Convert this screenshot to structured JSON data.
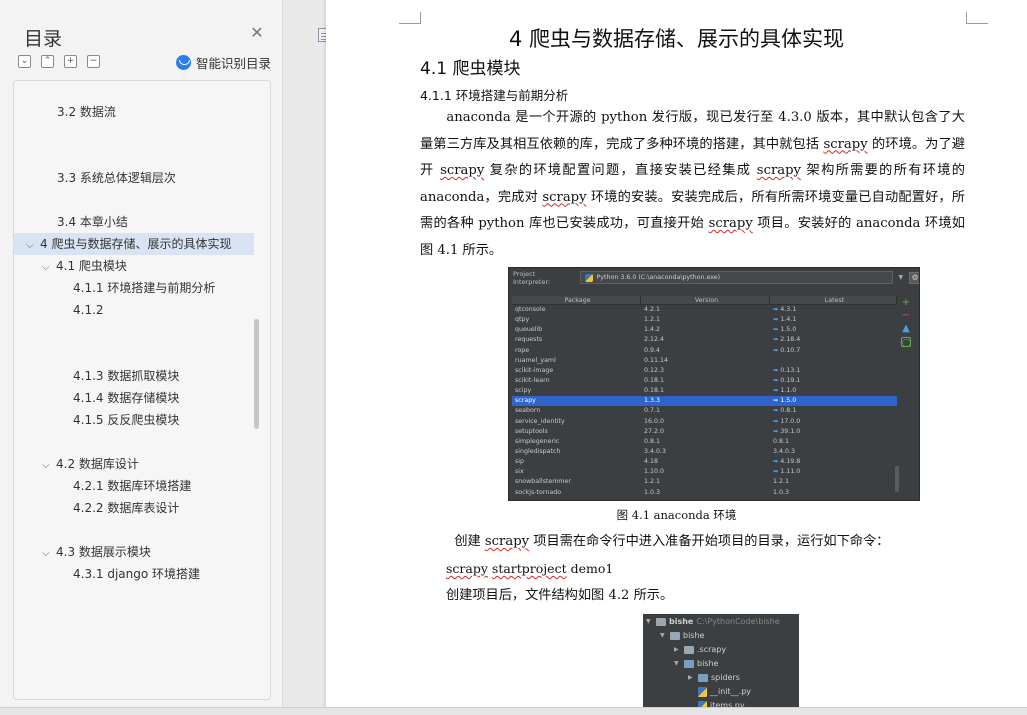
{
  "toc": {
    "title": "目录",
    "smart_label": "智能识别目录",
    "items": [
      {
        "label": "3.2  数据流",
        "level": 2
      },
      {
        "label": "3.3  系统总体逻辑层次",
        "level": 2
      },
      {
        "label": "3.4  本章小结",
        "level": 2
      },
      {
        "label": "4  爬虫与数据存储、展示的具体实现",
        "level": 1,
        "active": true
      },
      {
        "label": "4.1  爬虫模块",
        "level": 2
      },
      {
        "label": "4.1.1  环境搭建与前期分析",
        "level": 3
      },
      {
        "label": "4.1.2",
        "level": 3
      },
      {
        "label": "4.1.3  数据抓取模块",
        "level": 3
      },
      {
        "label": "4.1.4  数据存储模块",
        "level": 3
      },
      {
        "label": "4.1.5  反反爬虫模块",
        "level": 3
      },
      {
        "label": "4.2  数据库设计",
        "level": 2
      },
      {
        "label": "4.2.1  数据库环境搭建",
        "level": 3
      },
      {
        "label": "4.2.2  数据库表设计",
        "level": 3
      },
      {
        "label": "4.3  数据展示模块",
        "level": 2
      },
      {
        "label": "4.3.1 django 环境搭建",
        "level": 3
      }
    ]
  },
  "doc": {
    "chapter_title": "4  爬虫与数据存储、展示的具体实现",
    "section_title": "4.1  爬虫模块",
    "subsection_title": "4.1.1  环境搭建与前期分析",
    "para1": {
      "p1": "anaconda 是一个开源的 python 发行版，现已发行至 4.3.0 版本，其中默认包含了大量第三方库及其相互依赖的库，完成了多种环境的搭建，其中就包括 ",
      "w1": "scrapy",
      "p2": " 的环境。为了避开 ",
      "w2": "scrapy",
      "p3": " 复杂的环境配置问题，直接安装已经集成 ",
      "w3": "scrapy",
      "p4": " 架构所需要的所有环境的 anaconda，完成对 ",
      "w4": "scrapy",
      "p5": " 环境的安装。安装完成后，所有所需环境变量已自动配置好，所需的各种 python 库也已安装成功，可直接开始 ",
      "w5": "scrapy",
      "p6": " 项目。安装好的 anaconda 环境如图 4.1 所示。"
    },
    "fig1": {
      "interpreter_label": "Project Interpreter:",
      "interpreter_value": "Python 3.6.0 (C:\\anaconda\\python.exe)",
      "headers": [
        "Package",
        "Version",
        "Latest"
      ],
      "rows": [
        [
          "qtconsole",
          "4.2.1",
          "4.3.1",
          true
        ],
        [
          "qtpy",
          "1.2.1",
          "1.4.1",
          true
        ],
        [
          "queuelib",
          "1.4.2",
          "1.5.0",
          true
        ],
        [
          "requests",
          "2.12.4",
          "2.18.4",
          true
        ],
        [
          "rope",
          "0.9.4",
          "0.10.7",
          true
        ],
        [
          "ruamel_yaml",
          "0.11.14",
          "",
          false
        ],
        [
          "scikit-image",
          "0.12.3",
          "0.13.1",
          true
        ],
        [
          "scikit-learn",
          "0.18.1",
          "0.19.1",
          true
        ],
        [
          "scipy",
          "0.18.1",
          "1.1.0",
          true
        ],
        [
          "scrapy",
          "1.3.3",
          "1.5.0",
          true
        ],
        [
          "seaborn",
          "0.7.1",
          "0.8.1",
          true
        ],
        [
          "service_identity",
          "16.0.0",
          "17.0.0",
          true
        ],
        [
          "setuptools",
          "27.2.0",
          "39.1.0",
          true
        ],
        [
          "simplegeneric",
          "0.8.1",
          "0.8.1",
          false
        ],
        [
          "singledispatch",
          "3.4.0.3",
          "3.4.0.3",
          false
        ],
        [
          "sip",
          "4.18",
          "4.19.8",
          true
        ],
        [
          "six",
          "1.10.0",
          "1.11.0",
          true
        ],
        [
          "snowballstemmer",
          "1.2.1",
          "1.2.1",
          false
        ],
        [
          "sockjs-tornado",
          "1.0.3",
          "1.0.3",
          false
        ]
      ],
      "selected_index": 9,
      "caption": "图 4.1 anaconda 环境"
    },
    "para2": {
      "p1": "创建 ",
      "w1": "scrapy",
      "p2": " 项目需在命令行中进入准备开始项目的目录，运行如下命令："
    },
    "command": {
      "w1": "scrapy",
      "w2": "startproject",
      "rest": " demo1"
    },
    "para3": "创建项目后，文件结构如图 4.2 所示。",
    "fig2": {
      "root_name": "bishe",
      "root_path": "C:\\PythonCode\\bishe",
      "items": [
        {
          "name": "bishe",
          "depth": 1,
          "open": true,
          "type": "folder"
        },
        {
          "name": ".scrapy",
          "depth": 2,
          "open": false,
          "type": "folder"
        },
        {
          "name": "bishe",
          "depth": 2,
          "open": true,
          "type": "folder"
        },
        {
          "name": "spiders",
          "depth": 3,
          "open": false,
          "type": "folder"
        },
        {
          "name": "__init__.py",
          "depth": 3,
          "type": "py"
        },
        {
          "name": "items.py",
          "depth": 3,
          "type": "py"
        }
      ]
    }
  }
}
